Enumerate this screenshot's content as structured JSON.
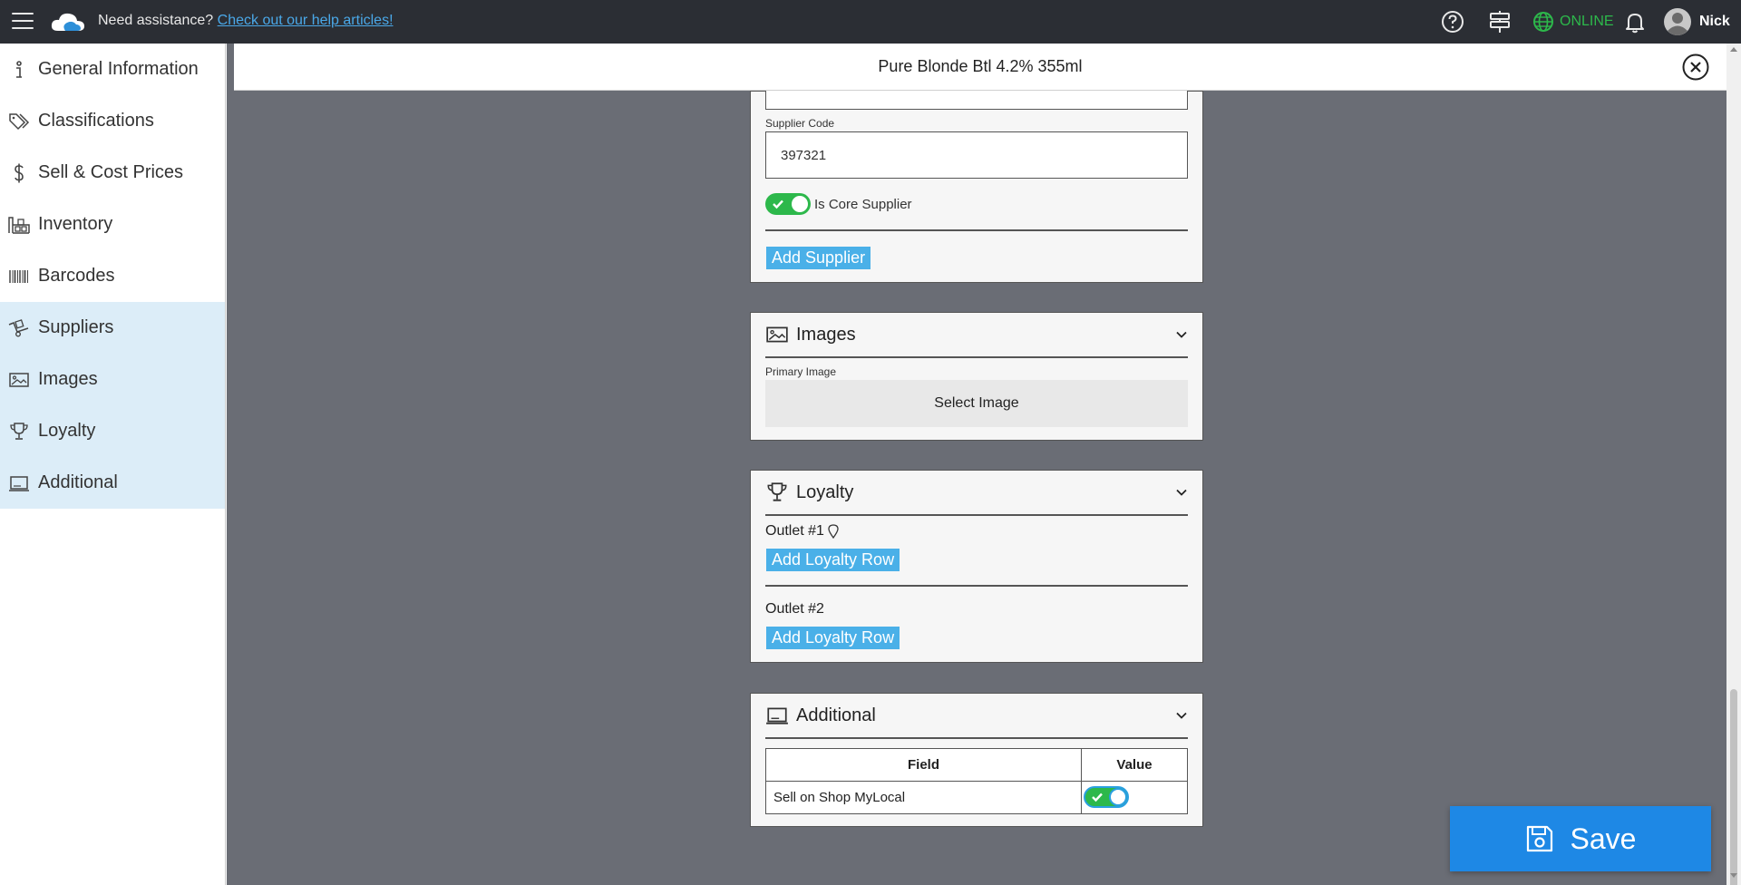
{
  "topbar": {
    "assist_text": "Need assistance?",
    "assist_link": "Check out our help articles!",
    "status": "ONLINE",
    "user_name": "Nick",
    "status_color": "#2db84b"
  },
  "sidebar": {
    "items": [
      {
        "label": "General Information",
        "icon": "info-icon"
      },
      {
        "label": "Classifications",
        "icon": "tags-icon"
      },
      {
        "label": "Sell & Cost Prices",
        "icon": "dollar-icon"
      },
      {
        "label": "Inventory",
        "icon": "warehouse-icon"
      },
      {
        "label": "Barcodes",
        "icon": "barcode-icon"
      },
      {
        "label": "Suppliers",
        "icon": "truck-icon"
      },
      {
        "label": "Images",
        "icon": "image-icon"
      },
      {
        "label": "Loyalty",
        "icon": "trophy-icon"
      },
      {
        "label": "Additional",
        "icon": "laptop-icon"
      }
    ]
  },
  "panel": {
    "title": "Pure Blonde Btl 4.2% 355ml"
  },
  "suppliers": {
    "supplier_code_label": "Supplier Code",
    "supplier_code_value": "397321",
    "core_supplier_label": "Is Core Supplier",
    "add_supplier": "Add Supplier"
  },
  "images": {
    "title": "Images",
    "primary_label": "Primary Image",
    "select_image": "Select Image"
  },
  "loyalty": {
    "title": "Loyalty",
    "outlet1": "Outlet #1",
    "outlet2": "Outlet #2",
    "add_row": "Add Loyalty Row"
  },
  "additional": {
    "title": "Additional",
    "col_field": "Field",
    "col_value": "Value",
    "row_field": "Sell on Shop MyLocal"
  },
  "save_label": "Save",
  "colors": {
    "accent": "#1e88e5",
    "button_blue": "#4ab0e8",
    "active_sidebar": "#dcedf8",
    "toggle_on": "#2db84b"
  }
}
